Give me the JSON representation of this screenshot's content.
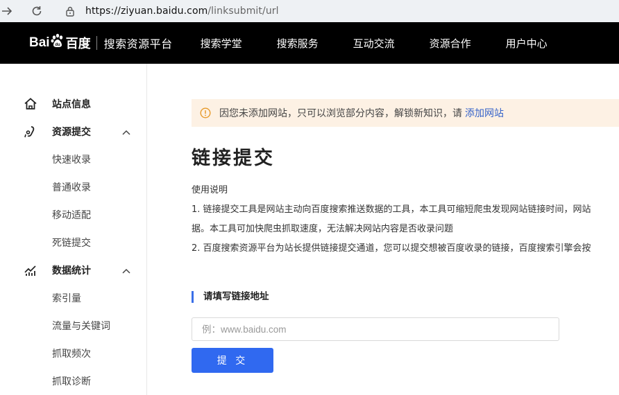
{
  "browser": {
    "url_host": "https://ziyuan.baidu.com",
    "url_path": "/linksubmit/url"
  },
  "topnav": {
    "logo_text_1": "Bai",
    "logo_text_2": "百度",
    "platform": "搜索资源平台",
    "items": [
      "搜索学堂",
      "搜索服务",
      "互动交流",
      "资源合作",
      "用户中心"
    ]
  },
  "sidebar": {
    "site_info": "站点信息",
    "resource_submit": "资源提交",
    "resource_items": [
      "快速收录",
      "普通收录",
      "移动适配",
      "死链提交"
    ],
    "data_stats": "数据统计",
    "stats_items": [
      "索引量",
      "流量与关键词",
      "抓取频次",
      "抓取诊断"
    ]
  },
  "notice": {
    "text": "因您未添加网站，只可以浏览部分内容，解锁新知识，请",
    "link": "添加网站"
  },
  "main": {
    "title": "链接提交",
    "usage_heading": "使用说明",
    "usage_lines": [
      "1. 链接提交工具是网站主动向百度搜索推送数据的工具，本工具可缩短爬虫发现网站链接时间，网站",
      "据。本工具可加快爬虫抓取速度，无法解决网站内容是否收录问题",
      "2. 百度搜索资源平台为站长提供链接提交通道，您可以提交想被百度收录的链接，百度搜索引擎会按"
    ],
    "section_heading": "请填写链接地址",
    "input_placeholder": "例：www.baidu.com",
    "submit_label": "提 交"
  },
  "colors": {
    "accent": "#3069f0",
    "notice_bg": "#fdf1e4",
    "nav_bg": "#000000"
  }
}
